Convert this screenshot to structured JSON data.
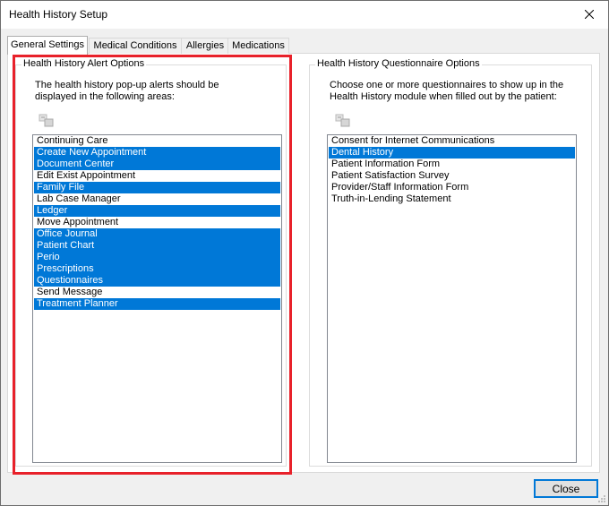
{
  "window": {
    "title": "Health History Setup"
  },
  "tabs": [
    {
      "label": "General Settings",
      "active": true
    },
    {
      "label": "Medical Conditions",
      "active": false
    },
    {
      "label": "Allergies",
      "active": false
    },
    {
      "label": "Medications",
      "active": false
    }
  ],
  "alert_options": {
    "title": "Health History Alert Options",
    "description_line1": "The health history pop-up alerts should be",
    "description_line2": "displayed in the following areas:",
    "icon": "select-all-icon",
    "items": [
      {
        "label": "Continuing Care",
        "selected": false
      },
      {
        "label": "Create New Appointment",
        "selected": true
      },
      {
        "label": "Document Center",
        "selected": true
      },
      {
        "label": "Edit Exist Appointment",
        "selected": false
      },
      {
        "label": "Family File",
        "selected": true
      },
      {
        "label": "Lab Case Manager",
        "selected": false
      },
      {
        "label": "Ledger",
        "selected": true
      },
      {
        "label": "Move Appointment",
        "selected": false
      },
      {
        "label": "Office Journal",
        "selected": true
      },
      {
        "label": "Patient Chart",
        "selected": true
      },
      {
        "label": "Perio",
        "selected": true
      },
      {
        "label": "Prescriptions",
        "selected": true
      },
      {
        "label": "Questionnaires",
        "selected": true
      },
      {
        "label": "Send Message",
        "selected": false
      },
      {
        "label": "Treatment Planner",
        "selected": true
      }
    ]
  },
  "questionnaire_options": {
    "title": "Health History Questionnaire Options",
    "description_line1": "Choose one or more questionnaires to show up in the",
    "description_line2": "Health History module when filled out by the patient:",
    "icon": "select-all-icon",
    "items": [
      {
        "label": "Consent for Internet Communications",
        "selected": false
      },
      {
        "label": "Dental History",
        "selected": true
      },
      {
        "label": "Patient Information Form",
        "selected": false
      },
      {
        "label": "Patient Satisfaction Survey",
        "selected": false
      },
      {
        "label": "Provider/Staff Information Form",
        "selected": false
      },
      {
        "label": "Truth-in-Lending Statement",
        "selected": false
      }
    ]
  },
  "footer": {
    "close_label": "Close"
  },
  "colors": {
    "selection": "#0078d7",
    "highlight_box": "#e8212a"
  }
}
